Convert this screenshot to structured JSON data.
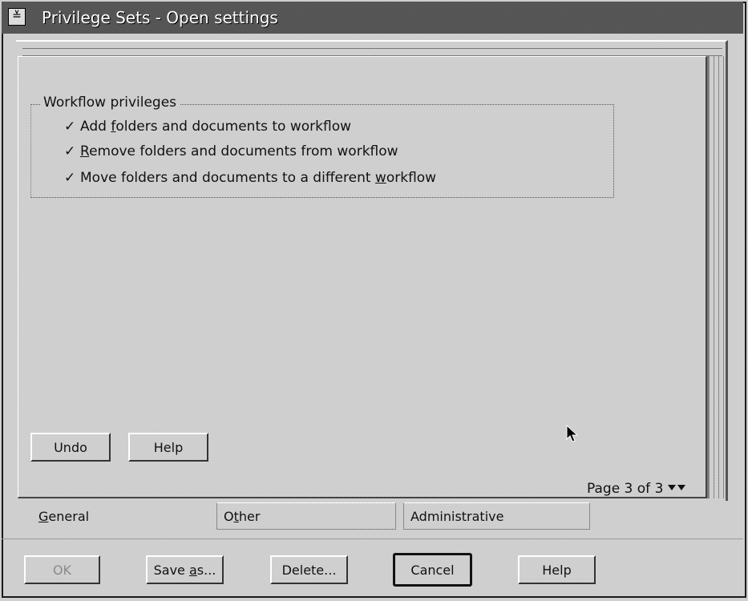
{
  "window": {
    "title": "Privilege Sets - Open settings",
    "sysmenu_glyph": "≚"
  },
  "group": {
    "title": "Workflow privileges",
    "checkboxes": [
      {
        "before": "Add ",
        "mnemonic": "f",
        "after": "olders and documents to workflow",
        "checked": true
      },
      {
        "before": "",
        "mnemonic": "R",
        "after": "emove folders and documents from workflow",
        "checked": true
      },
      {
        "before": "Move folders and documents to a different ",
        "mnemonic": "w",
        "after": "orkflow",
        "checked": true
      }
    ]
  },
  "page_buttons": {
    "undo": "Undo",
    "help": "Help"
  },
  "page_indicator": "Page 3 of 3",
  "tabs": [
    {
      "before": "",
      "mnemonic": "G",
      "after": "eneral",
      "active": true
    },
    {
      "before": "O",
      "mnemonic": "t",
      "after": "her",
      "active": false
    },
    {
      "before": "Administrative",
      "mnemonic": "",
      "after": "",
      "active": false
    }
  ],
  "footer_buttons": {
    "ok": "OK",
    "save_as_before": "Save ",
    "save_as_mnemonic": "a",
    "save_as_after": "s...",
    "delete": "Delete...",
    "cancel": "Cancel",
    "help": "Help"
  }
}
